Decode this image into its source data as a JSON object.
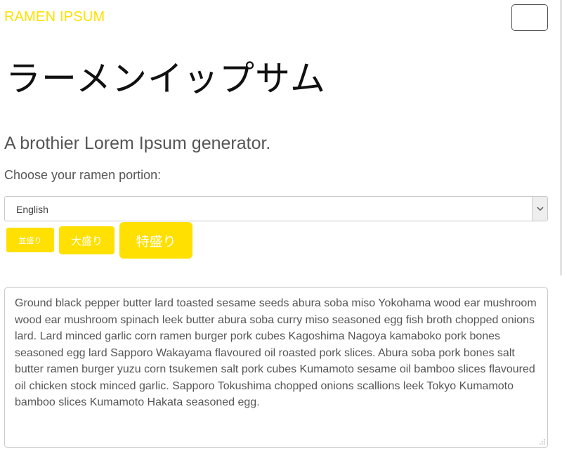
{
  "header": {
    "brand": "RAMEN IPSUM",
    "menu_button": {
      "icon": "hamburger-menu-icon"
    }
  },
  "hero": {
    "title_jp": "ラーメンイップサム",
    "tagline": "A brothier Lorem Ipsum generator."
  },
  "form": {
    "portion_label": "Choose your ramen portion:",
    "language_select": {
      "selected": "English"
    },
    "buttons": [
      {
        "label": "並盛り"
      },
      {
        "label": "大盛り"
      },
      {
        "label": "特盛り"
      }
    ]
  },
  "output": {
    "text": "Ground black pepper butter lard toasted sesame seeds abura soba miso Yokohama wood ear mushroom wood ear mushroom spinach leek butter abura soba curry miso seasoned egg fish broth chopped onions lard. Lard minced garlic corn ramen burger pork cubes Kagoshima Nagoya kamaboko pork bones seasoned egg lard Sapporo Wakayama flavoured oil roasted pork slices. Abura soba pork bones salt butter ramen burger yuzu corn tsukemen salt pork cubes Kumamoto sesame oil bamboo slices flavoured oil chicken stock minced garlic. Sapporo Tokushima chopped onions scallions leek Tokyo Kumamoto bamboo slices Kumamoto Hakata seasoned egg."
  },
  "colors": {
    "accent": "#ffe000",
    "text": "#555555",
    "title": "#111111"
  }
}
